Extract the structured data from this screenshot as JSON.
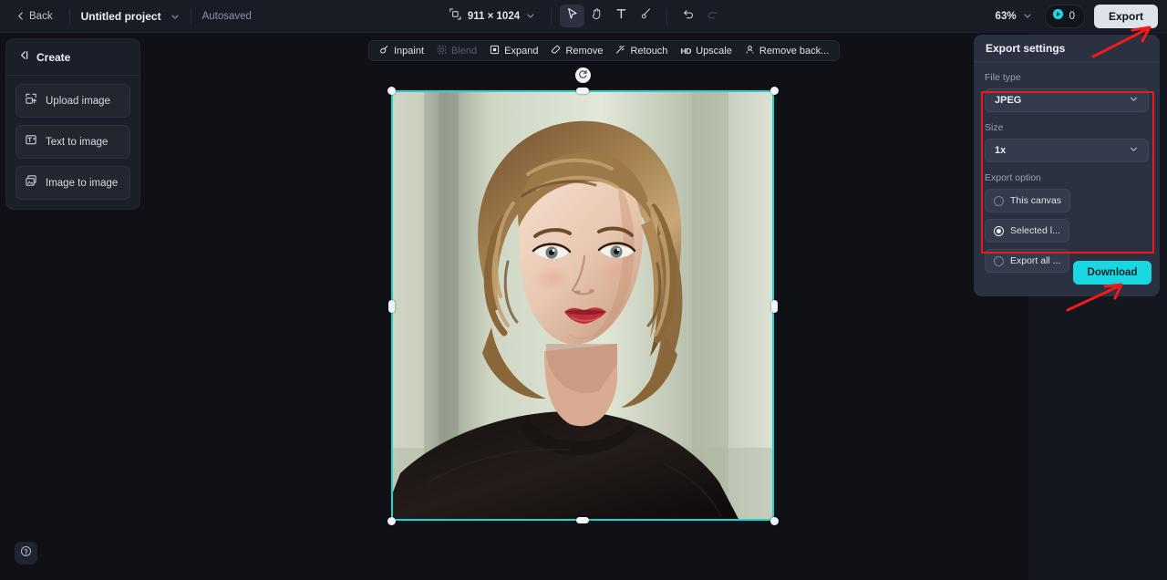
{
  "topbar": {
    "back_label": "Back",
    "project_name": "Untitled project",
    "autosave_label": "Autosaved",
    "canvas_size": "911 × 1024",
    "zoom_level": "63%",
    "credits_count": "0",
    "export_label": "Export",
    "tools": [
      {
        "name": "select-tool",
        "active": true
      },
      {
        "name": "hand-tool",
        "active": false
      },
      {
        "name": "text-tool",
        "active": false
      },
      {
        "name": "brush-tool",
        "active": false
      },
      {
        "name": "undo-tool",
        "active": false
      },
      {
        "name": "redo-tool",
        "active": false
      }
    ]
  },
  "create_panel": {
    "title": "Create",
    "items": [
      {
        "label": "Upload image",
        "icon": "upload-image-icon"
      },
      {
        "label": "Text to image",
        "icon": "text-to-image-icon"
      },
      {
        "label": "Image to image",
        "icon": "image-to-image-icon"
      }
    ]
  },
  "edit_toolbar": {
    "items": [
      {
        "label": "Inpaint",
        "icon": "inpaint-icon",
        "disabled": false
      },
      {
        "label": "Blend",
        "icon": "blend-icon",
        "disabled": true
      },
      {
        "label": "Expand",
        "icon": "expand-icon",
        "disabled": false
      },
      {
        "label": "Remove",
        "icon": "remove-icon",
        "disabled": false
      },
      {
        "label": "Retouch",
        "icon": "retouch-icon",
        "disabled": false
      },
      {
        "label": "Upscale",
        "icon": "hd-upscale-icon",
        "disabled": false
      },
      {
        "label": "Remove back...",
        "icon": "remove-background-icon",
        "disabled": false
      }
    ]
  },
  "export_panel": {
    "title": "Export settings",
    "file_type_label": "File type",
    "file_type_value": "JPEG",
    "size_label": "Size",
    "size_value": "1x",
    "export_option_label": "Export option",
    "options": [
      {
        "label": "This canvas",
        "selected": false
      },
      {
        "label": "Selected l...",
        "selected": true
      },
      {
        "label": "Export all ...",
        "selected": false
      }
    ],
    "download_label": "Download"
  },
  "colors": {
    "accent_cyan": "#1ad6e0",
    "selection_cyan": "#1ad6d6",
    "annotation_red": "#f01a1a",
    "panel_bg": "#2b3140",
    "app_bg": "#0f1116"
  },
  "help": {
    "icon": "question-mark-icon"
  }
}
